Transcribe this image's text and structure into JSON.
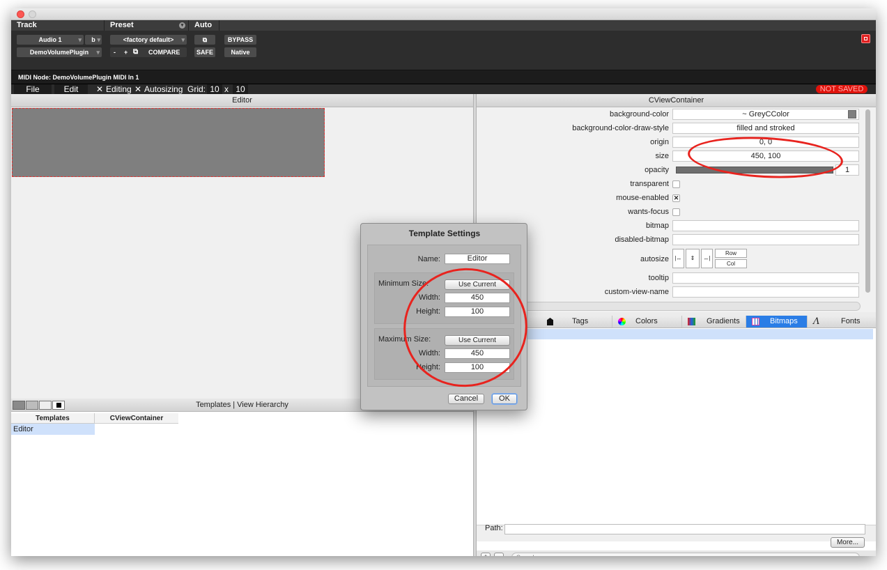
{
  "protools": {
    "track_header": "Track",
    "preset_header": "Preset",
    "auto_header": "Auto",
    "track_name": "Audio 1",
    "track_channel": "b",
    "plugin_name": "DemoVolumePlugin",
    "preset_value": "<factory default>",
    "preset_minus": "-",
    "preset_plus": "+",
    "compare": "COMPARE",
    "bypass": "BYPASS",
    "safe": "SAFE",
    "native": "Native"
  },
  "midi_node": "MIDI Node: DemoVolumePlugin MIDI In 1",
  "menubar": {
    "file": "File",
    "edit": "Edit",
    "editing_mark": "✕",
    "editing": "Editing",
    "autosizing_mark": "✕",
    "autosizing": "Autosizing",
    "grid_label": "Grid:",
    "grid_x": "10",
    "grid_by": "x",
    "grid_y": "10",
    "not_saved": "NOT SAVED",
    "not_saved_color": "#e0120b"
  },
  "editor": {
    "title": "Editor",
    "view_color": "#7f7f7f"
  },
  "templates_panel": {
    "title": "Templates | View Hierarchy",
    "col_templates": "Templates",
    "col_view": "CViewContainer",
    "rows": [
      "Editor"
    ]
  },
  "inspector": {
    "title": "CViewContainer",
    "props": [
      {
        "label": "background-color",
        "value": "~ GreyCColor"
      },
      {
        "label": "background-color-draw-style",
        "value": "filled and stroked"
      },
      {
        "label": "origin",
        "value": "0, 0"
      },
      {
        "label": "size",
        "value": "450, 100"
      },
      {
        "label": "opacity",
        "value": "1"
      },
      {
        "label": "transparent",
        "value": ""
      },
      {
        "label": "mouse-enabled",
        "value": "✕"
      },
      {
        "label": "wants-focus",
        "value": ""
      },
      {
        "label": "bitmap",
        "value": ""
      },
      {
        "label": "disabled-bitmap",
        "value": ""
      },
      {
        "label": "autosize",
        "value": ""
      },
      {
        "label": "tooltip",
        "value": ""
      },
      {
        "label": "custom-view-name",
        "value": ""
      }
    ],
    "autosize_row": "Row",
    "autosize_col": "Col"
  },
  "resource_tabs": [
    {
      "label": "Tags",
      "icon": "tag-icon",
      "selected": false
    },
    {
      "label": "Colors",
      "icon": "color-wheel-icon",
      "selected": false
    },
    {
      "label": "Gradients",
      "icon": "gradient-icon",
      "selected": false
    },
    {
      "label": "Bitmaps",
      "icon": "bitmap-grid-icon",
      "selected": true
    },
    {
      "label": "Fonts",
      "icon": "font-icon",
      "selected": false
    }
  ],
  "resources_footer": {
    "path_label": "Path:",
    "more": "More...",
    "add": "+",
    "remove": "-",
    "search_placeholder": "Search"
  },
  "dialog": {
    "title": "Template Settings",
    "name_label": "Name:",
    "name_value": "Editor",
    "min_label": "Minimum Size:",
    "max_label": "Maximum Size:",
    "use_current": "Use Current",
    "width_label": "Width:",
    "height_label": "Height:",
    "min_width": "450",
    "min_height": "100",
    "max_width": "450",
    "max_height": "100",
    "cancel": "Cancel",
    "ok": "OK"
  }
}
